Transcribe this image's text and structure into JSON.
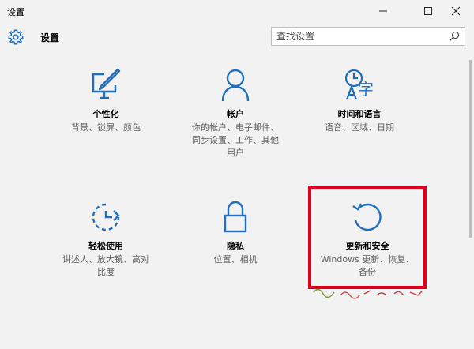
{
  "window": {
    "title": "设置",
    "controls": {
      "minimize": "—",
      "maximize": "☐",
      "close": "✕"
    }
  },
  "header": {
    "title": "设置",
    "icon": "gear-icon"
  },
  "search": {
    "placeholder": "查找设置",
    "icon": "search-icon"
  },
  "tiles": [
    {
      "name": "个性化",
      "desc": "背景、锁屏、颜色",
      "icon": "personalization-icon"
    },
    {
      "name": "帐户",
      "desc": "你的帐户、电子邮件、同步设置、工作、其他用户",
      "icon": "account-icon"
    },
    {
      "name": "时间和语言",
      "desc": "语音、区域、日期",
      "icon": "time-language-icon"
    },
    {
      "name": "轻松使用",
      "desc": "讲述人、放大镜、高对比度",
      "icon": "ease-of-access-icon"
    },
    {
      "name": "隐私",
      "desc": "位置、相机",
      "icon": "privacy-icon"
    },
    {
      "name": "更新和安全",
      "desc": "Windows 更新、恢复、备份",
      "icon": "update-security-icon"
    }
  ],
  "colors": {
    "accent": "#1e6fbf",
    "highlight_border": "#e0001b",
    "background": "#f2f2f2"
  }
}
